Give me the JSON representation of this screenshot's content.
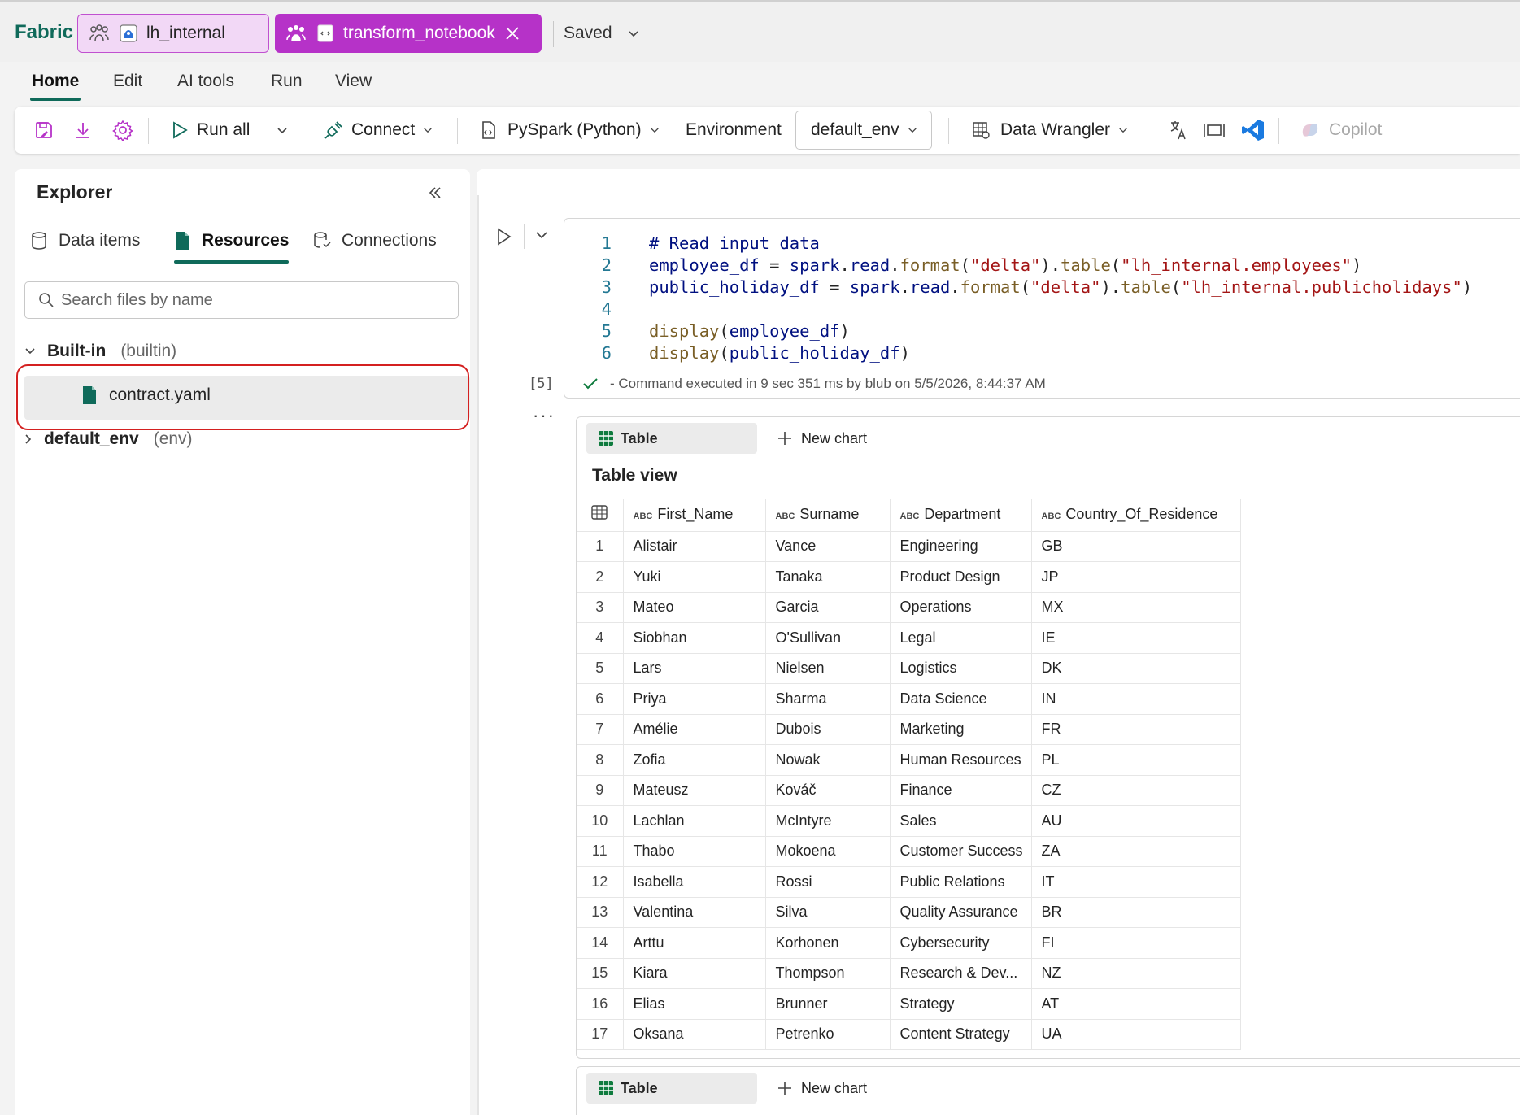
{
  "app": {
    "brand": "Fabric",
    "saved_label": "Saved"
  },
  "window_tabs": [
    {
      "label": "lh_internal"
    },
    {
      "label": "transform_notebook"
    }
  ],
  "menu": [
    "Home",
    "Edit",
    "AI tools",
    "Run",
    "View"
  ],
  "ribbon": {
    "run_all": "Run all",
    "connect": "Connect",
    "language": "PySpark (Python)",
    "environment_label": "Environment",
    "environment_value": "default_env",
    "data_wrangler": "Data Wrangler",
    "copilot": "Copilot"
  },
  "explorer": {
    "title": "Explorer",
    "tabs": [
      "Data items",
      "Resources",
      "Connections"
    ],
    "search_placeholder": "Search files by name",
    "tree": {
      "builtin_label": "Built-in",
      "builtin_sub": "(builtin)",
      "file": "contract.yaml",
      "env_label": "default_env",
      "env_sub": "(env)"
    }
  },
  "cell": {
    "line_numbers": [
      "1",
      "2",
      "3",
      "4",
      "5",
      "6"
    ],
    "lines": [
      "# Read input data",
      "employee_df = spark.read.format(\"delta\").table(\"lh_internal.employees\")",
      "public_holiday_df = spark.read.format(\"delta\").table(\"lh_internal.publicholidays\")",
      "",
      "display(employee_df)",
      "display(public_holiday_df)"
    ],
    "exec_count": "[5]",
    "exec_status": "- Command executed in 9 sec 351 ms by blub on 5/5/2026, 8:44:37 AM"
  },
  "output": {
    "table_btn": "Table",
    "new_chart_btn": "New chart",
    "table_title": "Table view",
    "columns": [
      "First_Name",
      "Surname",
      "Department",
      "Country_Of_Residence"
    ],
    "type_tag": "ABC",
    "rows": [
      [
        "1",
        "Alistair",
        "Vance",
        "Engineering",
        "GB"
      ],
      [
        "2",
        "Yuki",
        "Tanaka",
        "Product Design",
        "JP"
      ],
      [
        "3",
        "Mateo",
        "Garcia",
        "Operations",
        "MX"
      ],
      [
        "4",
        "Siobhan",
        "O'Sullivan",
        "Legal",
        "IE"
      ],
      [
        "5",
        "Lars",
        "Nielsen",
        "Logistics",
        "DK"
      ],
      [
        "6",
        "Priya",
        "Sharma",
        "Data Science",
        "IN"
      ],
      [
        "7",
        "Amélie",
        "Dubois",
        "Marketing",
        "FR"
      ],
      [
        "8",
        "Zofia",
        "Nowak",
        "Human Resources",
        "PL"
      ],
      [
        "9",
        "Mateusz",
        "Kováč",
        "Finance",
        "CZ"
      ],
      [
        "10",
        "Lachlan",
        "McIntyre",
        "Sales",
        "AU"
      ],
      [
        "11",
        "Thabo",
        "Mokoena",
        "Customer Success",
        "ZA"
      ],
      [
        "12",
        "Isabella",
        "Rossi",
        "Public Relations",
        "IT"
      ],
      [
        "13",
        "Valentina",
        "Silva",
        "Quality Assurance",
        "BR"
      ],
      [
        "14",
        "Arttu",
        "Korhonen",
        "Cybersecurity",
        "FI"
      ],
      [
        "15",
        "Kiara",
        "Thompson",
        "Research & Dev...",
        "NZ"
      ],
      [
        "16",
        "Elias",
        "Brunner",
        "Strategy",
        "AT"
      ],
      [
        "17",
        "Oksana",
        "Petrenko",
        "Content Strategy",
        "UA"
      ]
    ],
    "second_table_btn": "Table",
    "second_new_chart_btn": "New chart"
  },
  "colors": {
    "accent": "#0f6a5a",
    "tab_active": "#b632c8",
    "tab_inactive": "#f2d8f6",
    "highlight": "#d42020"
  }
}
